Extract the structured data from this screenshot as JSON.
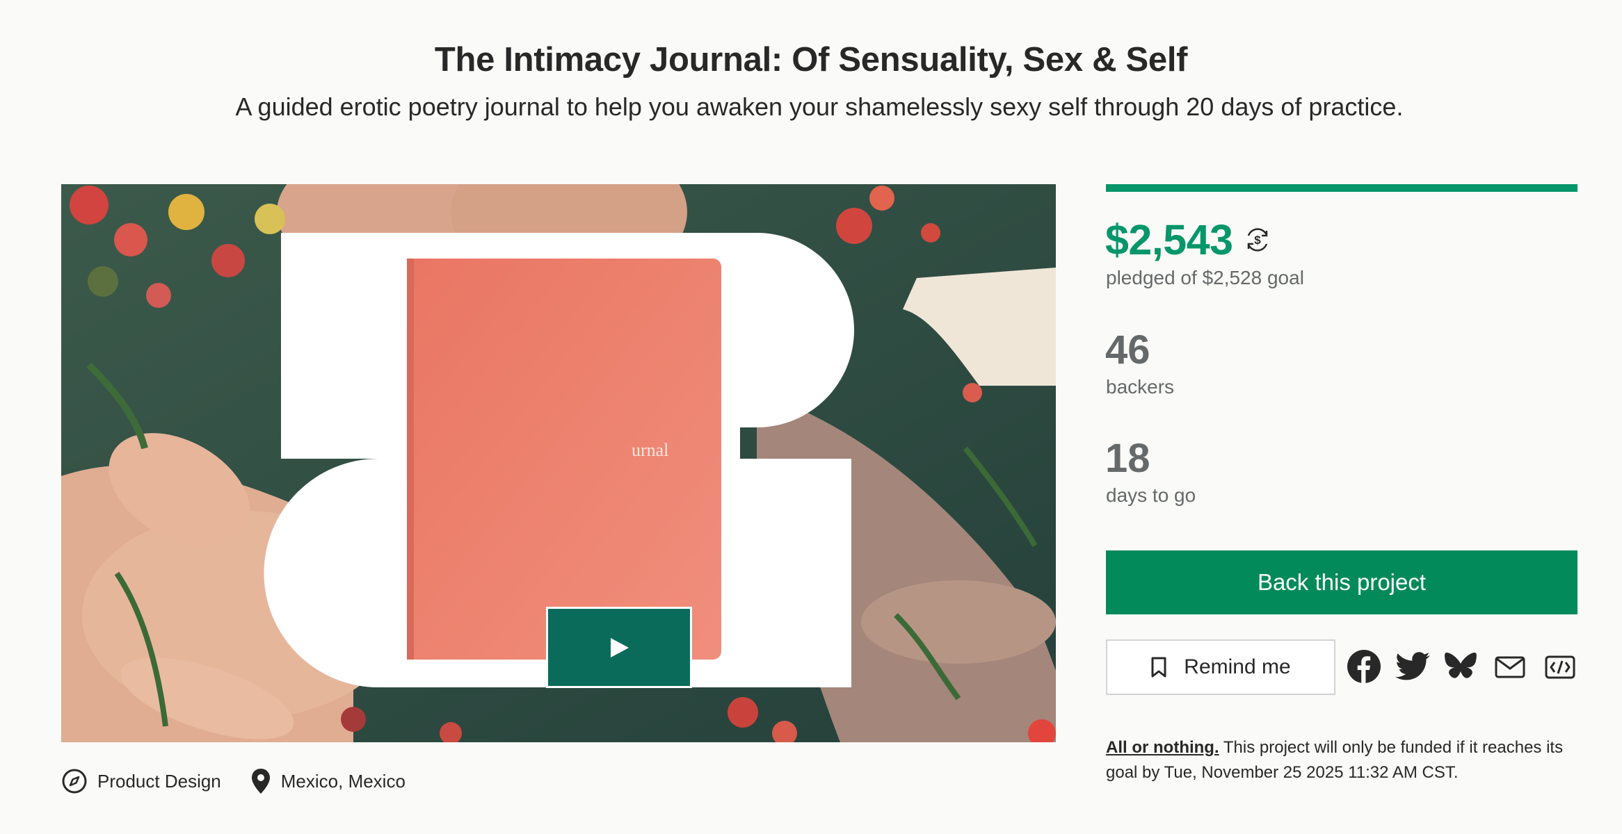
{
  "project": {
    "title": "The Intimacy Journal: Of Sensuality, Sex & Self",
    "subtitle": "A guided erotic poetry journal to help you awaken your shamelessly sexy self through 20 days of practice."
  },
  "media": {
    "book_text": "urnal",
    "play_icon": "play-icon"
  },
  "meta": {
    "category": "Product Design",
    "category_icon": "compass-icon",
    "location": "Mexico, Mexico",
    "location_icon": "map-pin-icon"
  },
  "funding": {
    "progress_fraction": 1.0,
    "pledged": "$2,543",
    "pledged_label": "pledged of $2,528 goal",
    "backers": "46",
    "backers_label": "backers",
    "days": "18",
    "days_label": "days to go"
  },
  "actions": {
    "back_label": "Back this project",
    "remind_label": "Remind me",
    "share_icons": [
      "facebook-icon",
      "twitter-icon",
      "bluesky-icon",
      "email-icon",
      "embed-icon"
    ]
  },
  "fine_print": {
    "link": "All or nothing.",
    "text": " This project will only be funded if it reaches its goal by Tue, November 25 2025 11:32 AM CST."
  },
  "colors": {
    "accent": "#05966a",
    "button": "#038a5a",
    "play_button": "#0b6b5b",
    "muted_text": "#656969",
    "book_cover": "#ef8a78"
  }
}
